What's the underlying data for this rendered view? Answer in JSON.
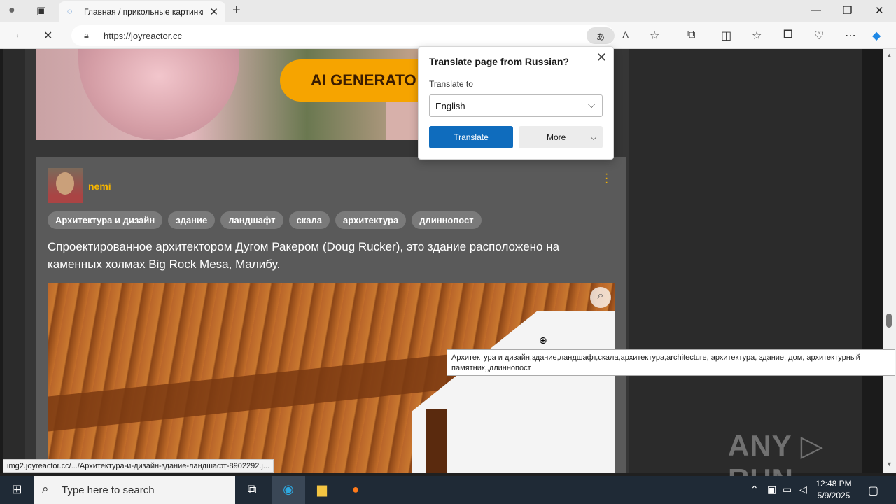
{
  "browser": {
    "tab_title": "Главная / прикольные картинки",
    "url": "https://joyreactor.cc",
    "status_url": "img2.joyreactor.cc/.../Архитектура-и-дизайн-здание-ландшафт-8902292.j..."
  },
  "translate_popup": {
    "title": "Translate page from Russian?",
    "translate_to_label": "Translate to",
    "language": "English",
    "translate_button": "Translate",
    "more_button": "More"
  },
  "page": {
    "banner_button": "AI GENERATO",
    "post": {
      "username": "nemi",
      "tags": [
        "Архитектура и дизайн",
        "здание",
        "ландшафт",
        "скала",
        "архитектура",
        "длиннопост"
      ],
      "description": "Спроектированное архитектором Дугом Ракером (Doug Rucker), это здание расположено на каменных холмах Big Rock Mesa, Малибу."
    },
    "tooltip": "Архитектура и дизайн,здание,ландшафт,скала,архитектура,architecture, архитектура, здание, дом, архитектурный памятник,,длиннопост",
    "watermark": "ANY ▷ RUN"
  },
  "taskbar": {
    "search_placeholder": "Type here to search",
    "time": "12:48 PM",
    "date": "5/9/2025"
  }
}
